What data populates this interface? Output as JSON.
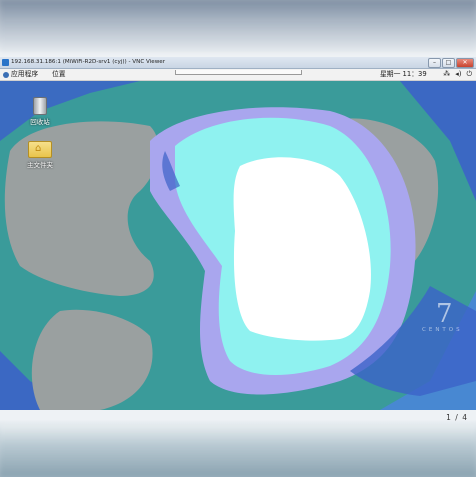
{
  "window": {
    "title": "192.168.31.186:1 (MiWiFi-R2D-srv1 (cyj)) - VNC Viewer",
    "buttons": {
      "minimize": "–",
      "maximize": "□",
      "close": "✕"
    }
  },
  "gnome_panel": {
    "applications_label": "应用程序",
    "places_label": "位置",
    "clock": "星期一 11：39",
    "tray_icons": [
      "network-icon",
      "volume-icon",
      "power-icon"
    ]
  },
  "desktop": {
    "icons": [
      {
        "label": "回收站",
        "icon": "trash-icon"
      },
      {
        "label": "主文件夹",
        "icon": "home-folder-icon"
      }
    ],
    "os_badge": {
      "numeral": "7",
      "text": "CENTOS"
    },
    "colors": {
      "teal": "#3a9b9a",
      "gray": "#9aa0a0",
      "lavender": "#a9a6ee",
      "cyan": "#8ff2f0",
      "white": "#ffffff",
      "deep_blue": "#3c63c8"
    }
  },
  "pager": {
    "text": "1 / 4"
  }
}
